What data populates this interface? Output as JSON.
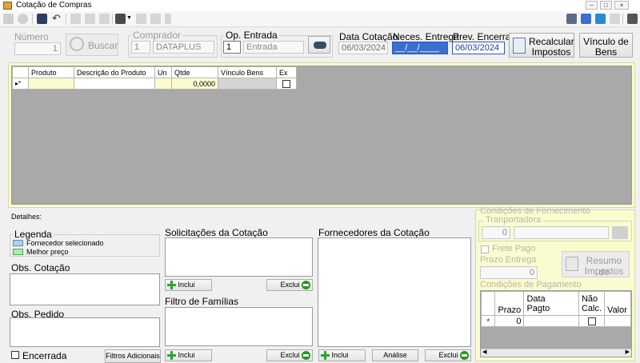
{
  "window": {
    "title": "Cotação de Compras"
  },
  "header": {
    "numero": {
      "label": "Número",
      "value": "1"
    },
    "buscar": "Buscar",
    "comprador": {
      "label": "Comprador",
      "code": "1",
      "name": "DATAPLUS"
    },
    "op_entrada": {
      "label": "Op. Entrada",
      "code": "1",
      "name": "Entrada"
    },
    "data_cotacao": {
      "label": "Data Cotação",
      "value": "06/03/2024"
    },
    "neces_entrega": {
      "label": "Neces. Entrega",
      "value": "__/__/____"
    },
    "prev_encerra": {
      "label": "Prev. Encerra.",
      "value": "06/03/2024"
    },
    "recalcular": {
      "line1": "Recalcular",
      "line2": "Impostos"
    },
    "vinculo": {
      "line1": "Vínculo de",
      "line2": "Bens"
    }
  },
  "products_grid": {
    "columns": [
      "Produto",
      "Descrição do Produto",
      "Un",
      "Qtde",
      "Vínculo Bens",
      "Ex"
    ],
    "new_row": {
      "marker": "▸*",
      "qtde": "0,0000"
    }
  },
  "details": {
    "label": "Detalhes:",
    "legenda": {
      "title": "Legenda",
      "items": [
        {
          "label": "Fornecedor selecionado",
          "color": "#a9d3ee"
        },
        {
          "label": "Melhor preço",
          "color": "#a6f0a6"
        }
      ]
    },
    "obs_cotacao": "Obs. Cotação",
    "obs_pedido": "Obs. Pedido",
    "encerrada": "Encerrada",
    "filtros": "Filtros Adicionais"
  },
  "solicitacoes": {
    "title": "Solicitações da Cotação",
    "inclui": "Inclui",
    "exclui": "Exclui"
  },
  "familias": {
    "title": "Filtro de Famílias",
    "inclui": "Inclui",
    "exclui": "Exclui"
  },
  "fornecedores": {
    "title": "Fornecedores da Cotação",
    "inclui": "Inclui",
    "analise": "Análise",
    "exclui": "Exclui"
  },
  "fornecimento": {
    "title": "Condições de Fornecimento",
    "transportadora": {
      "label": "Tranportadora",
      "code": "0"
    },
    "frete_pago": "Frete Pago",
    "prazo_entrega": {
      "label": "Prazo Entrega",
      "value": "0"
    },
    "resumo": {
      "line1": "Resumo de",
      "line2": "Impostos"
    }
  },
  "pagamento": {
    "title": "Condições de Pagamento",
    "columns": [
      "Prazo",
      "Data\nPagto",
      "Não\nCalc.",
      "Valor"
    ],
    "row": {
      "marker": "*",
      "prazo": "0"
    }
  }
}
